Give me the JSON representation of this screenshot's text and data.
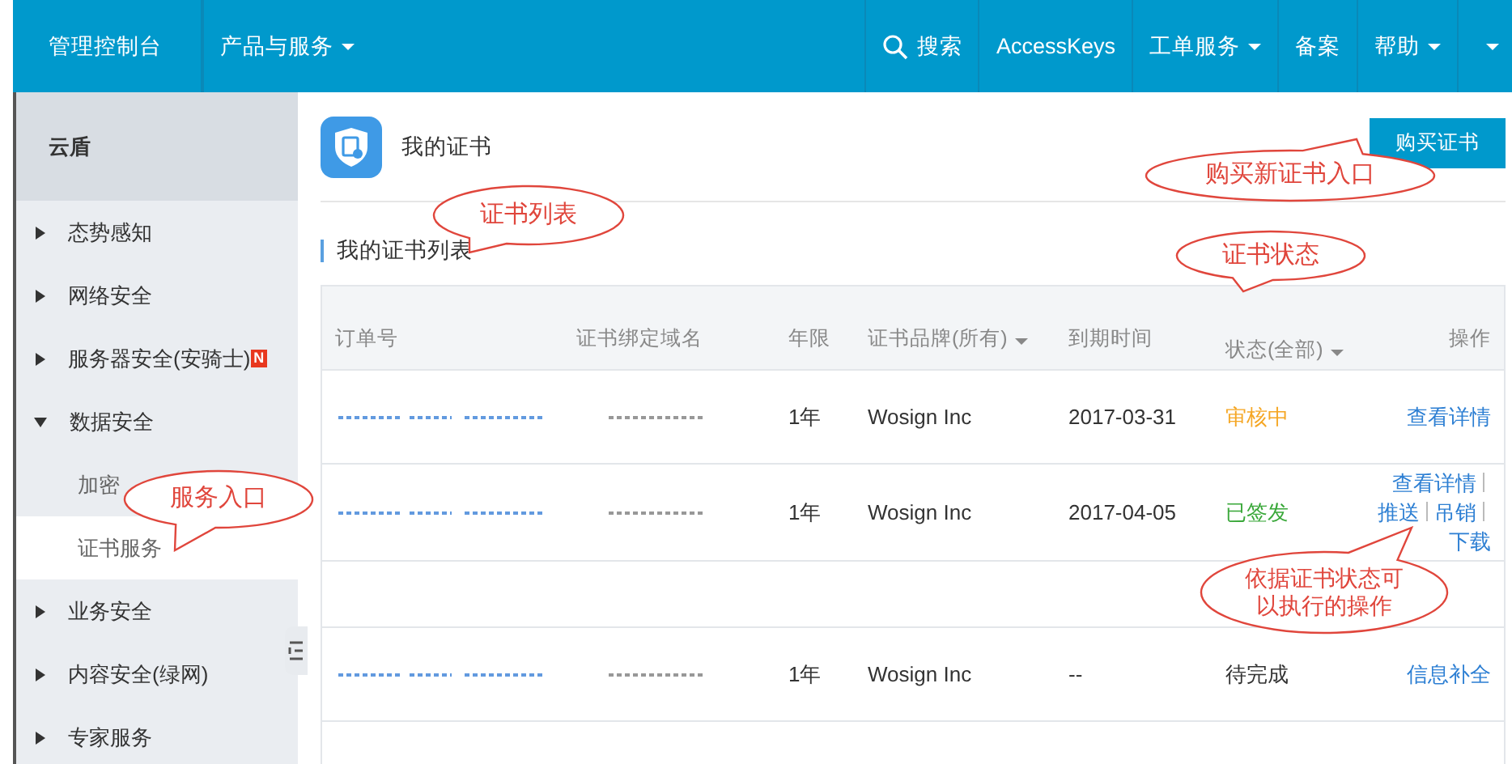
{
  "top_nav": {
    "home": "管理控制台",
    "left_items": [
      {
        "label": "产品与服务",
        "has_menu": true
      }
    ],
    "search": "搜索",
    "right_items": [
      {
        "label": "AccessKeys",
        "has_menu": false
      },
      {
        "label": "工单服务",
        "has_menu": true
      },
      {
        "label": "备案",
        "has_menu": false
      },
      {
        "label": "帮助",
        "has_menu": true
      }
    ],
    "more_menu": true
  },
  "sidebar": {
    "title": "云盾",
    "items": [
      {
        "label": "态势感知",
        "expanded": false,
        "selected": false
      },
      {
        "label": "网络安全",
        "expanded": false,
        "selected": false
      },
      {
        "label": "服务器安全(安骑士)",
        "expanded": false,
        "selected": false,
        "badge": "N"
      },
      {
        "label": "数据安全",
        "expanded": true,
        "selected": false,
        "children": [
          {
            "label": "加密",
            "selected": false
          },
          {
            "label": "证书服务",
            "selected": true
          }
        ]
      },
      {
        "label": "业务安全",
        "expanded": false,
        "selected": false
      },
      {
        "label": "内容安全(绿网)",
        "expanded": false,
        "selected": false
      },
      {
        "label": "专家服务",
        "expanded": false,
        "selected": false
      }
    ]
  },
  "page": {
    "title": "我的证书",
    "buy_button": "购买证书",
    "section_title": "我的证书列表"
  },
  "table": {
    "columns": [
      {
        "label": "订单号",
        "has_filter": false
      },
      {
        "label": "证书绑定域名",
        "has_filter": false
      },
      {
        "label": "年限",
        "has_filter": false
      },
      {
        "label": "证书品牌(所有)",
        "has_filter": true
      },
      {
        "label": "到期时间",
        "has_filter": false
      },
      {
        "label": "状态(全部)",
        "has_filter": true
      },
      {
        "label": "操作",
        "has_filter": false
      }
    ],
    "rows": [
      {
        "kind": "order",
        "term": "1年",
        "brand": "Wosign Inc",
        "expiry": "2017-03-31",
        "status": "审核中",
        "color": "#f5a623",
        "actions": [
          "查看详情"
        ]
      },
      {
        "kind": "order",
        "term": "1年",
        "brand": "Wosign Inc",
        "expiry": "2017-04-05",
        "status": "已签发",
        "color": "#3aa83a",
        "actions": [
          "查看详情",
          "推送",
          "吊销",
          "下载"
        ]
      },
      {
        "kind": "blank"
      },
      {
        "kind": "order",
        "term": "1年",
        "brand": "Wosign Inc",
        "expiry": "--",
        "status": "待完成",
        "color": "#333333",
        "actions": [
          "信息补全"
        ]
      }
    ]
  },
  "callouts": [
    "证书列表",
    "购买新证书入口",
    "证书状态",
    "服务入口",
    "依据证书状态可以执行的操作"
  ]
}
